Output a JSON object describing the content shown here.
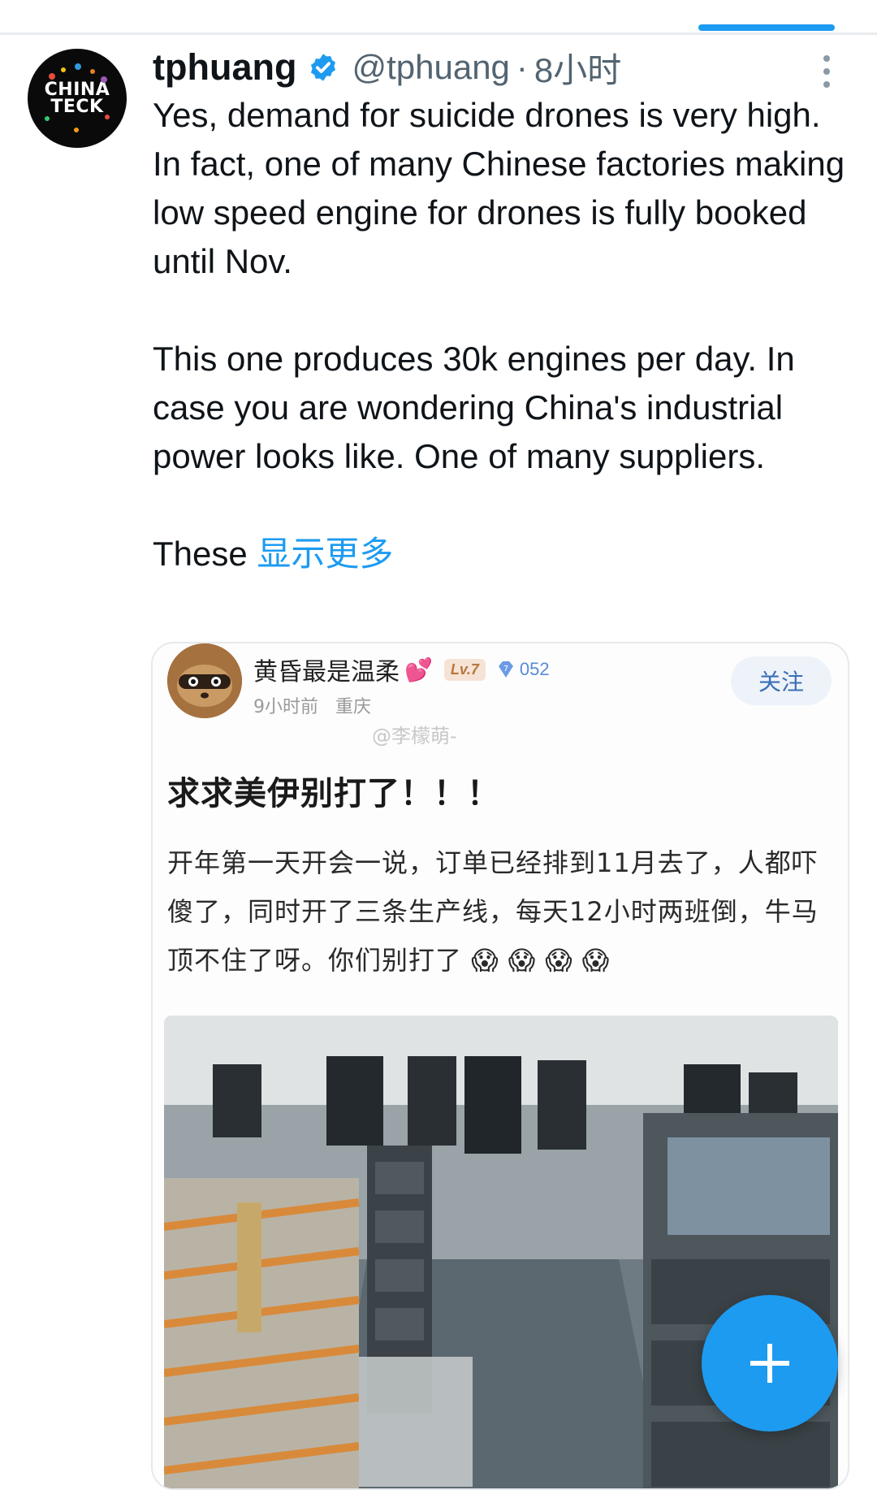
{
  "tweet": {
    "author_name": "tphuang",
    "handle": "@tphuang",
    "separator": "·",
    "time": "8小时",
    "avatar_lines": [
      "CHINA",
      "TECK"
    ],
    "text_para1": "Yes, demand for suicide drones is very high. In fact, one of many Chinese factories making low speed engine for drones is fully booked until Nov.",
    "text_para2": "This one produces 30k engines per day. In case you are wondering China's industrial power looks like. One of many suppliers.",
    "text_para3_start": "These",
    "show_more": "显示更多"
  },
  "embedded_post": {
    "username": "黄昏最是温柔",
    "heart": "💕",
    "level": "Lv.7",
    "gem_level": "7",
    "gem_count": "052",
    "meta_time": "9小时前",
    "meta_location": "重庆",
    "follow_label": "关注",
    "watermark": "@李檬萌-",
    "title": "求求美伊别打了！！！",
    "body": "开年第一天开会一说，订单已经排到11月去了，人都吓傻了，同时开了三条生产线，每天12小时两班倒，牛马顶不住了呀。你们别打了",
    "emoji_face": "😱"
  },
  "colors": {
    "accent": "#1d9bf0",
    "secondary_text": "#536471",
    "primary_text": "#0f1419"
  },
  "icons": {
    "verified": "verified-badge-icon",
    "more": "more-vertical-icon",
    "compose": "plus-icon",
    "gem": "diamond-icon"
  }
}
